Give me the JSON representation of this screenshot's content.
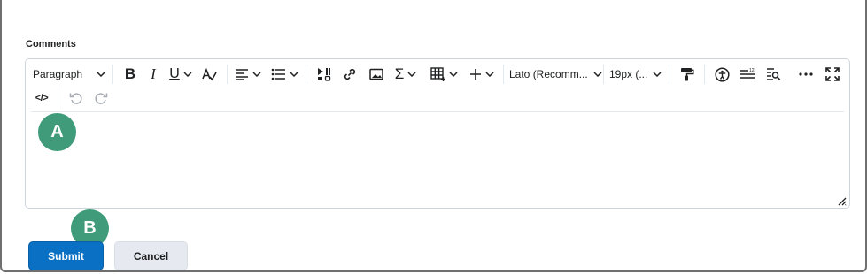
{
  "form": {
    "comments_label": "Comments"
  },
  "toolbar": {
    "paragraph_label": "Paragraph",
    "font_family_label": "Lato (Recomm...",
    "font_size_label": "19px (..."
  },
  "callouts": {
    "a": "A",
    "b": "B"
  },
  "buttons": {
    "submit_label": "Submit",
    "cancel_label": "Cancel"
  },
  "colors": {
    "primary_button": "#0a70c4",
    "callout": "#3f9b79",
    "secondary_button": "#e6eaf0"
  }
}
